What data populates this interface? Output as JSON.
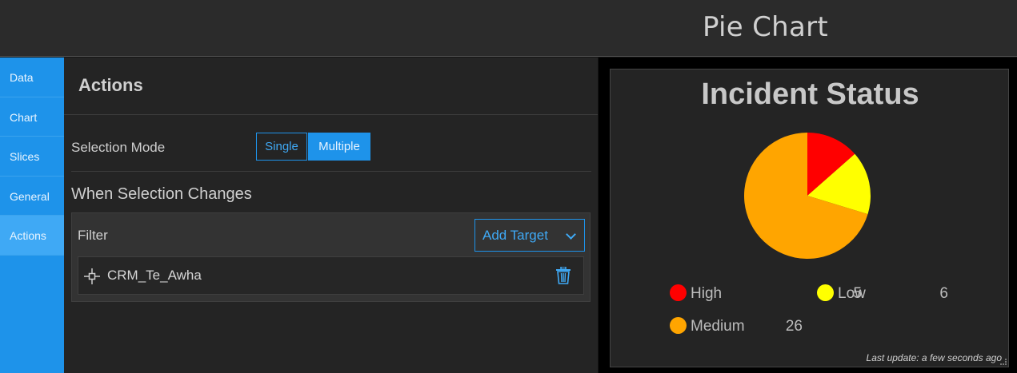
{
  "header": {
    "title": "Pie Chart"
  },
  "sidenav": {
    "items": [
      "Data",
      "Chart",
      "Slices",
      "General",
      "Actions"
    ],
    "active": "Actions"
  },
  "panel": {
    "title": "Actions",
    "selection_mode_label": "Selection Mode",
    "modes": {
      "single": "Single",
      "multiple": "Multiple",
      "selected": "Multiple"
    },
    "when_changes_label": "When Selection Changes",
    "filter_label": "Filter",
    "add_target_label": "Add Target",
    "targets": [
      {
        "name": "CRM_Te_Awha"
      }
    ]
  },
  "preview": {
    "last_update": "Last update: a few seconds ago"
  },
  "chart_data": {
    "type": "pie",
    "title": "Incident Status",
    "categories": [
      "High",
      "Low",
      "Medium"
    ],
    "values": [
      5,
      6,
      26
    ],
    "colors": [
      "#ff0000",
      "#ffff00",
      "#ffa500"
    ],
    "legend_position": "bottom"
  },
  "colors": {
    "accent": "#1e93ea",
    "accent_light": "#3fa9f5",
    "panel_bg": "#242424"
  }
}
